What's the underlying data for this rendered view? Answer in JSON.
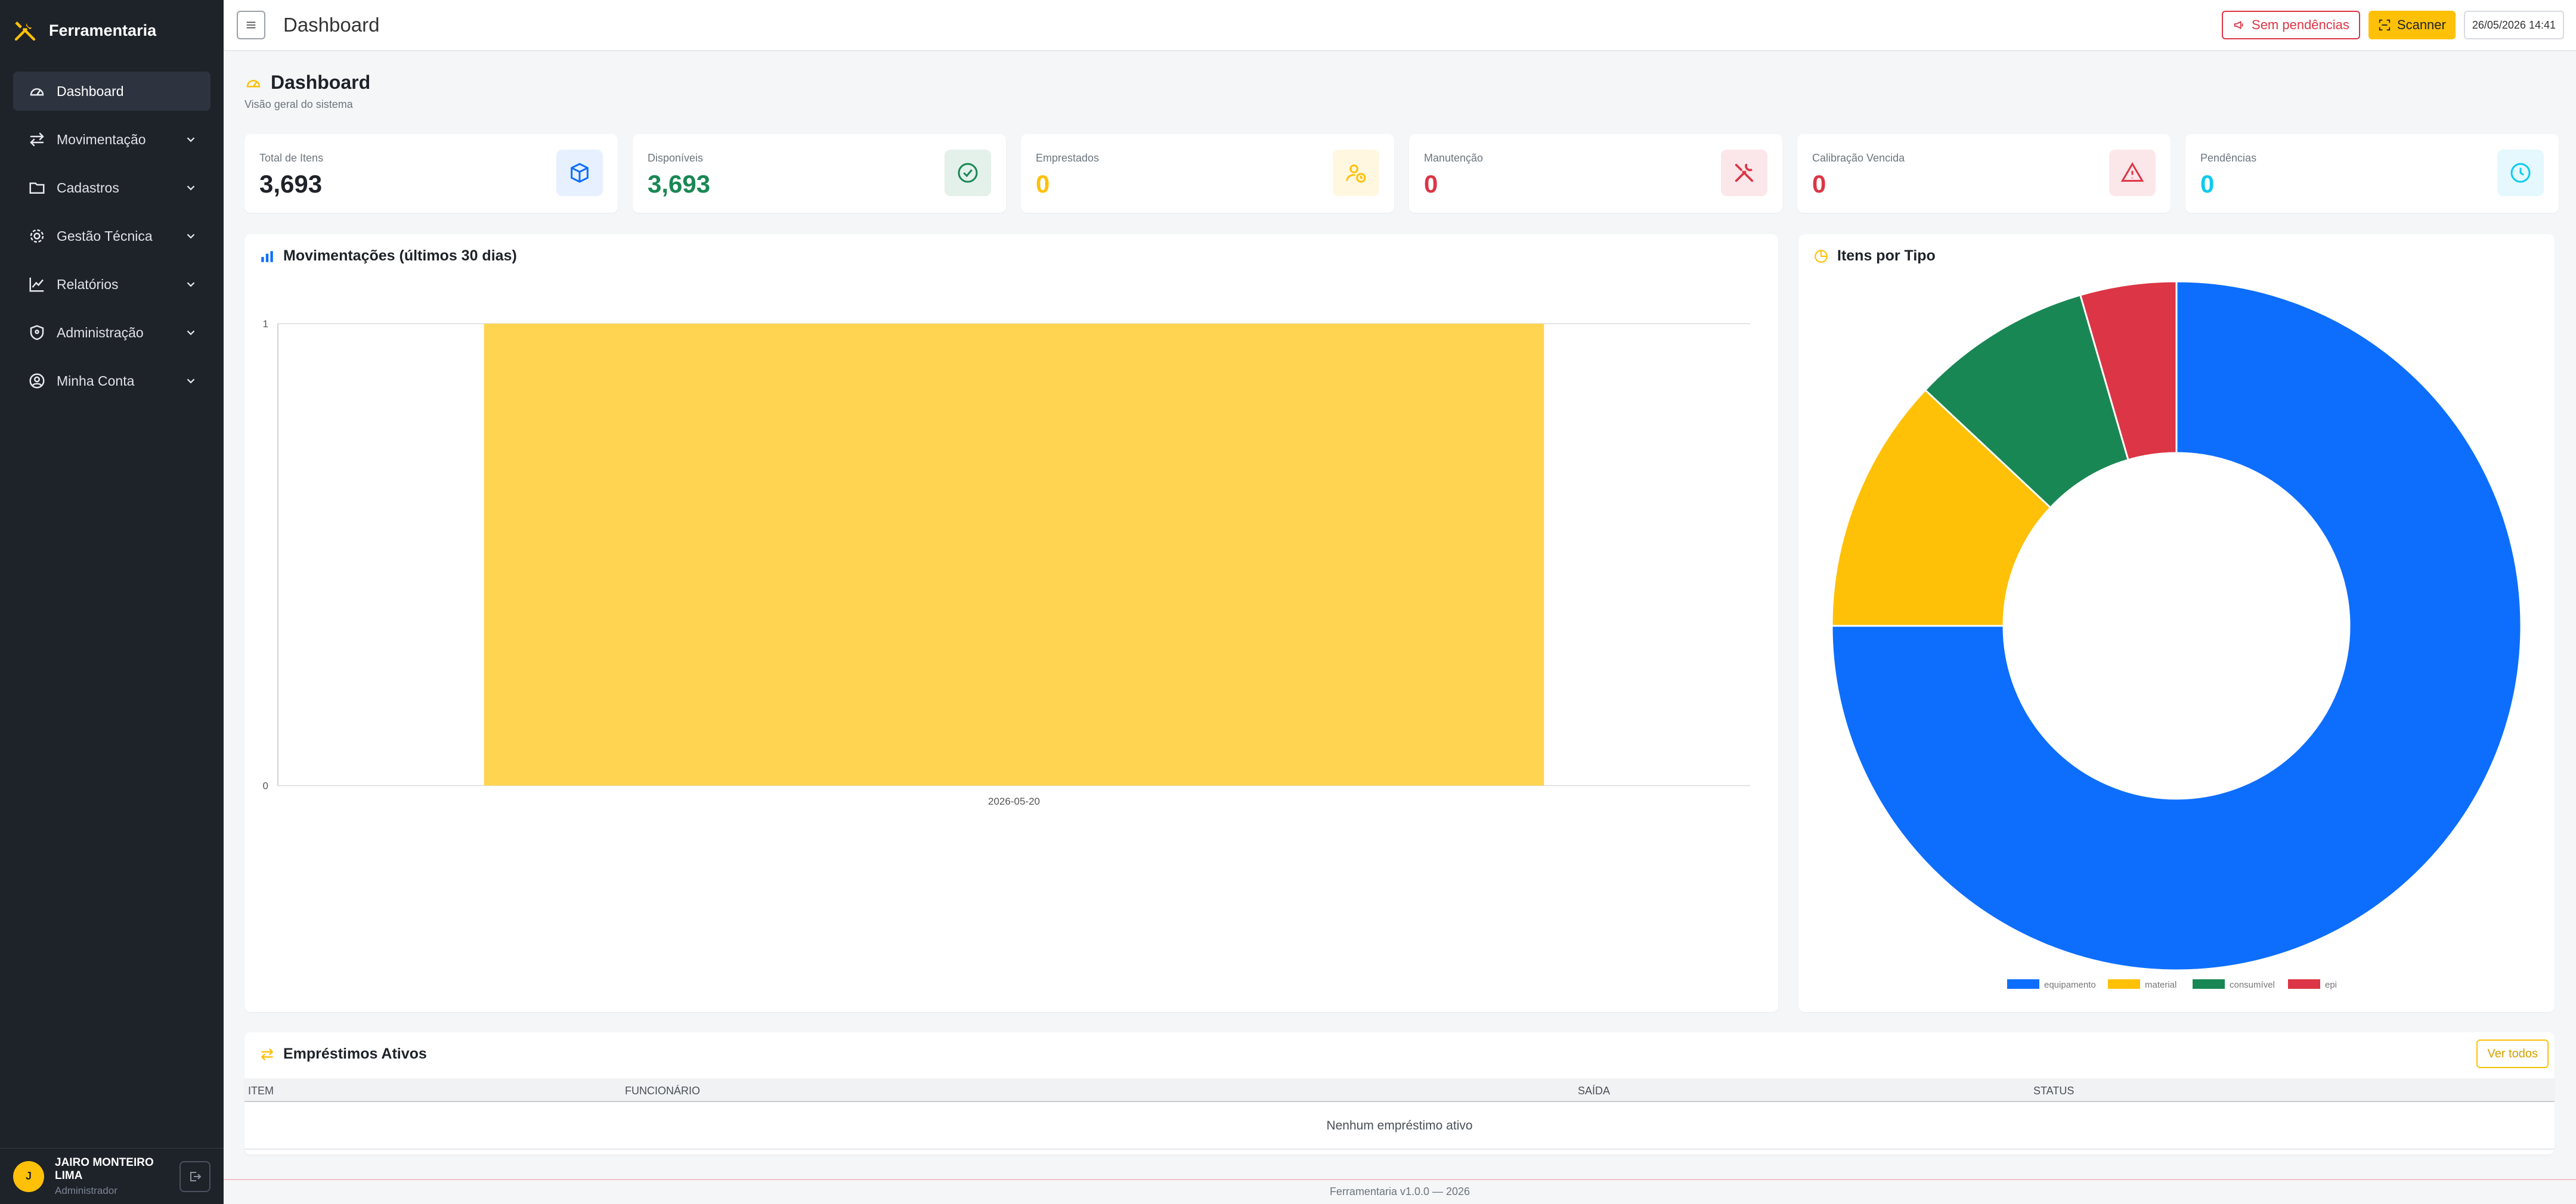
{
  "app": {
    "brand": "Ferramentaria"
  },
  "sidebar": {
    "items": [
      {
        "label": "Dashboard",
        "icon": "gauge-icon",
        "active": true
      },
      {
        "label": "Movimentação",
        "icon": "arrows-exchange-icon"
      },
      {
        "label": "Cadastros",
        "icon": "folder-icon"
      },
      {
        "label": "Gestão Técnica",
        "icon": "gear-icon"
      },
      {
        "label": "Relatórios",
        "icon": "line-chart-icon"
      },
      {
        "label": "Administração",
        "icon": "shield-icon"
      },
      {
        "label": "Minha Conta",
        "icon": "user-circle-icon"
      }
    ],
    "user": {
      "initial": "J",
      "name": "JAIRO MONTEIRO LIMA",
      "role": "Administrador"
    }
  },
  "topbar": {
    "title": "Dashboard",
    "pending_label": "Sem pendências",
    "scanner_label": "Scanner",
    "datetime": "26/05/2026 14:41"
  },
  "page": {
    "title": "Dashboard",
    "subtitle": "Visão geral do sistema"
  },
  "stats": [
    {
      "label": "Total de Itens",
      "value": "3,693",
      "color": "#1e2229",
      "icon": "box-icon",
      "icon_color": "#0d6efd",
      "icon_bg": "#e7f0fe"
    },
    {
      "label": "Disponíveis",
      "value": "3,693",
      "color": "#198754",
      "icon": "check-circle-icon",
      "icon_color": "#198754",
      "icon_bg": "#e3f1ea"
    },
    {
      "label": "Emprestados",
      "value": "0",
      "color": "#ffc107",
      "icon": "user-clock-icon",
      "icon_color": "#ffc107",
      "icon_bg": "#fff7e0"
    },
    {
      "label": "Manutenção",
      "value": "0",
      "color": "#dc3545",
      "icon": "tools-icon",
      "icon_color": "#dc3545",
      "icon_bg": "#fbe7e9"
    },
    {
      "label": "Calibração Vencida",
      "value": "0",
      "color": "#dc3545",
      "icon": "warning-icon",
      "icon_color": "#dc3545",
      "icon_bg": "#fbe7e9"
    },
    {
      "label": "Pendências",
      "value": "0",
      "color": "#0dcaf0",
      "icon": "clock-icon",
      "icon_color": "#0dcaf0",
      "icon_bg": "#e4f8fd"
    }
  ],
  "movimentacoes": {
    "title": "Movimentações (últimos 30 dias)",
    "chart_data": {
      "type": "bar",
      "categories": [
        "2026-05-20"
      ],
      "values": [
        1
      ],
      "ylim": [
        0,
        1
      ],
      "yticks": [
        "0",
        "1"
      ],
      "bar_color": "#ffd451",
      "grid": true
    }
  },
  "tipos": {
    "title": "Itens por Tipo",
    "chart_data": {
      "type": "pie",
      "donut": true,
      "categories": [
        "equipamento",
        "material",
        "consumível",
        "epi"
      ],
      "values": [
        75,
        12,
        8.5,
        4.5
      ],
      "colors": [
        "#0d6efd",
        "#ffc107",
        "#198754",
        "#dc3545"
      ],
      "legend": "bottom"
    }
  },
  "emprestimos": {
    "title": "Empréstimos Ativos",
    "view_all": "Ver todos",
    "columns": [
      "ITEM",
      "FUNCIONÁRIO",
      "SAÍDA",
      "STATUS"
    ],
    "empty": "Nenhum empréstimo ativo"
  },
  "footer": {
    "text": "Ferramentaria v1.0.0 — 2026"
  }
}
